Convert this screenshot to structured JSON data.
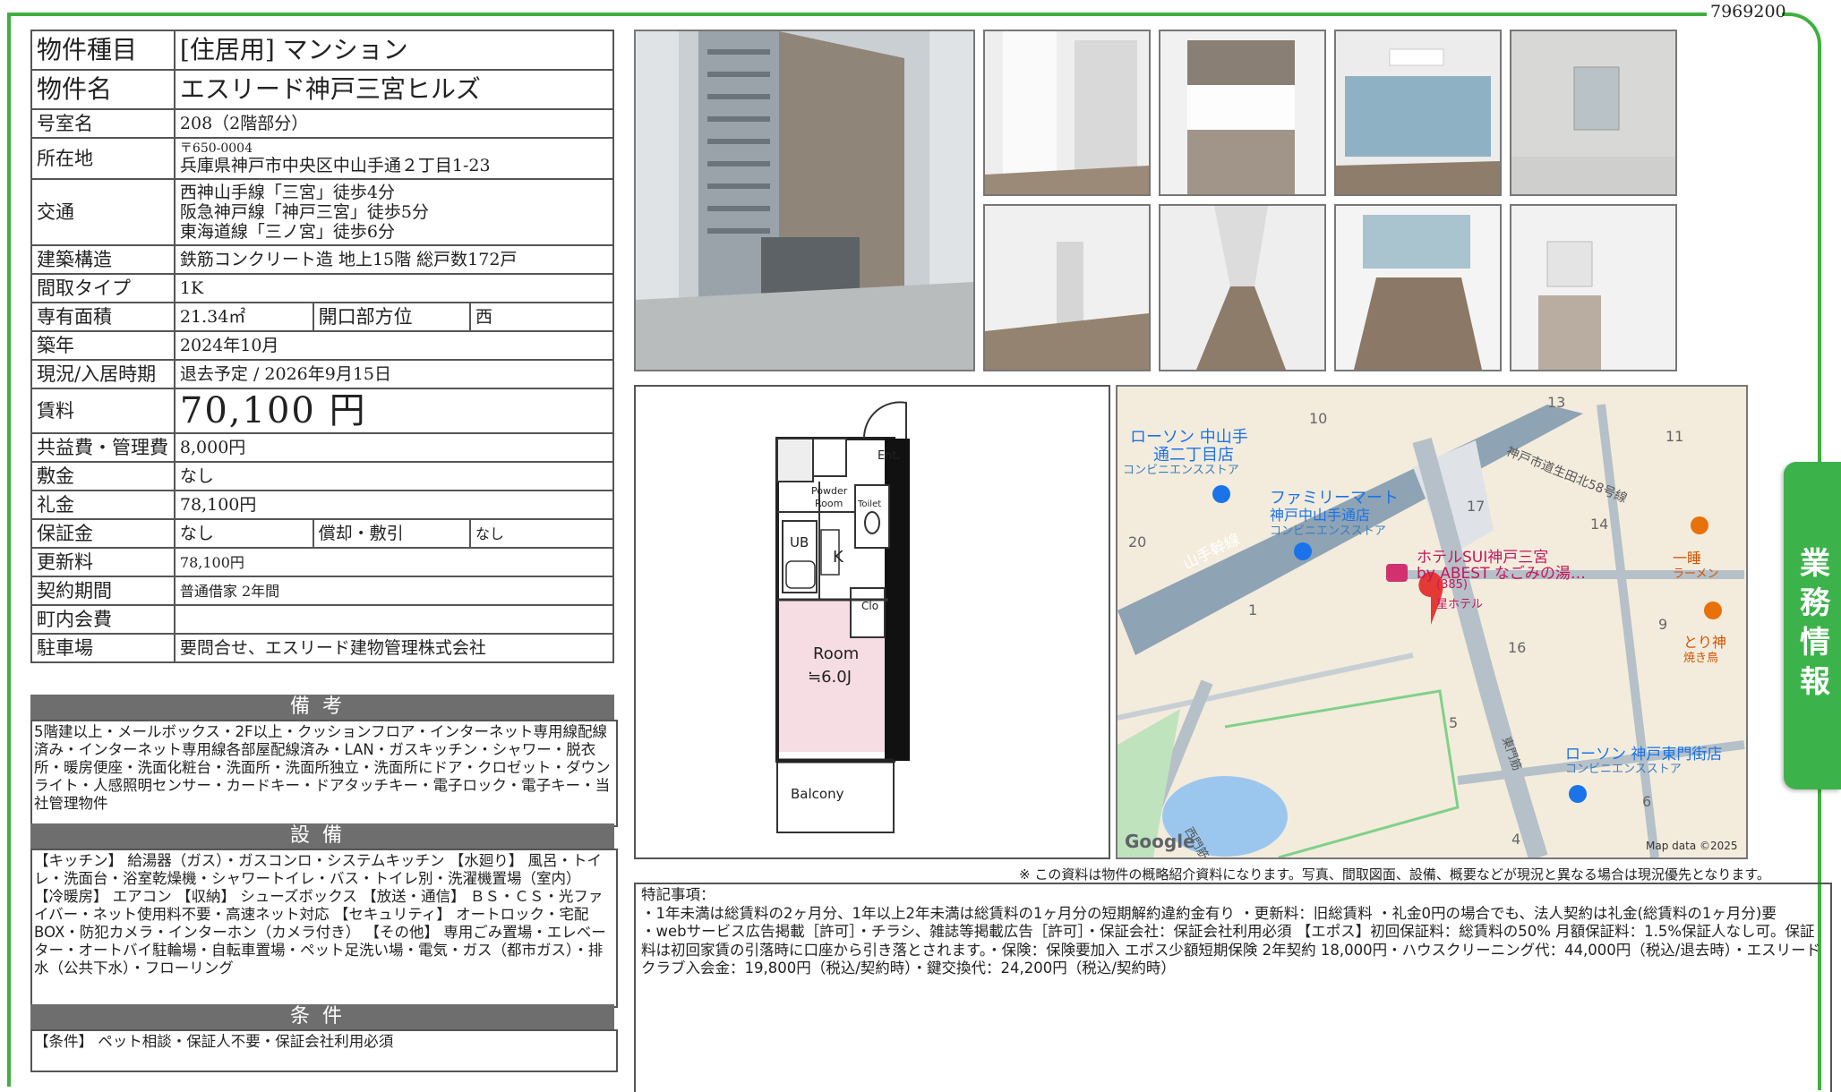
{
  "doc_id": "7969200",
  "side_tab": "業務情報",
  "spec": {
    "type_label": "物件種目",
    "type_value": "[住居用]  マンション",
    "name_label": "物件名",
    "name_value": "エスリード神戸三宮ヒルズ",
    "room_label": "号室名",
    "room_value": "208（2階部分）",
    "addr_label": "所在地",
    "addr_zip": "〒650-0004",
    "addr_value": "兵庫県神戸市中央区中山手通２丁目1-23",
    "access_label": "交通",
    "access_1": "西神山手線「三宮」徒歩4分",
    "access_2": "阪急神戸線「神戸三宮」徒歩5分",
    "access_3": "東海道線「三ノ宮」徒歩6分",
    "struct_label": "建築構造",
    "struct_value": "鉄筋コンクリート造  地上15階  総戸数172戸",
    "layout_label": "間取タイプ",
    "layout_value": "1K",
    "area_label": "専有面積",
    "area_value": "21.34㎡",
    "dir_label": "開口部方位",
    "dir_value": "西",
    "year_label": "築年",
    "year_value": "2024年10月",
    "status_label": "現況/入居時期",
    "status_value": "退去予定  /  2026年9月15日",
    "rent_label": "賃料",
    "rent_value": "70,100 円",
    "fee_label": "共益費・管理費",
    "fee_value": "8,000円",
    "deposit_label": "敷金",
    "deposit_value": "なし",
    "key_label": "礼金",
    "key_value": "78,100円",
    "guarantee_label": "保証金",
    "guarantee_value": "なし",
    "amort_label": "償却・敷引",
    "amort_value": "なし",
    "renew_label": "更新料",
    "renew_value": "78,100円",
    "contract_label": "契約期間",
    "contract_value": "普通借家  2年間",
    "town_label": "町内会費",
    "town_value": "",
    "parking_label": "駐車場",
    "parking_value": "要問合せ、エスリード建物管理株式会社"
  },
  "bikou": {
    "title": "備考",
    "text": "5階建以上・メールボックス・2F以上・クッションフロア・インターネット専用線配線済み・インターネット専用線各部屋配線済み・LAN・ガスキッチン・シャワー・脱衣所・暖房便座・洗面化粧台・洗面所・洗面所独立・洗面所にドア・クロゼット・ダウンライト・人感照明センサー・カードキー・ドアタッチキー・電子ロック・電子キー・当社管理物件"
  },
  "setsubi": {
    "title": "設備",
    "text": "【キッチン】 給湯器（ガス）・ガスコンロ・システムキッチン 【水廻り】 風呂・トイレ・洗面台・浴室乾燥機・シャワートイレ・バス・トイレ別・洗濯機置場（室内） 【冷暖房】 エアコン 【収納】 シューズボックス 【放送・通信】 ＢＳ・ＣＳ・光ファイバー・ネット使用料不要・高速ネット対応 【セキュリティ】 オートロック・宅配BOX・防犯カメラ・インターホン（カメラ付き） 【その他】 専用ごみ置場・エレベーター・オートバイ駐輪場・自転車置場・ペット足洗い場・電気・ガス（都市ガス）・排水（公共下水）・フローリング"
  },
  "jouken": {
    "title": "条件",
    "text": "【条件】 ペット相談・保証人不要・保証会社利用必須"
  },
  "floorplan": {
    "ent": "Ent.",
    "powder": "Powder",
    "room_word": "Room",
    "toilet": "Toilet",
    "ub": "UB",
    "k": "K",
    "clo": "Clo",
    "room_label": "Room",
    "room_size": "≒6.0J",
    "balcony": "Balcony"
  },
  "map": {
    "labels": [
      {
        "t": "ローソン 中山手",
        "c": "#1a73e8"
      },
      {
        "t": "通二丁目店",
        "c": "#1a73e8"
      },
      {
        "t": "コンビニエンスストア",
        "c": "#3c7dbb"
      },
      {
        "t": "ファミリーマート",
        "c": "#1a73e8"
      },
      {
        "t": "神戸中山手通店",
        "c": "#1a73e8"
      },
      {
        "t": "コンビニエンスストア",
        "c": "#3c7dbb"
      },
      {
        "t": "ホテルSUI神戸三宮",
        "c": "#c2185b"
      },
      {
        "t": "by ABEST なごみの湯…",
        "c": "#c2185b"
      },
      {
        "t": "(385)",
        "c": "#c2185b"
      },
      {
        "t": "星ホテル",
        "c": "#c2185b"
      },
      {
        "t": "一睡",
        "c": "#d35400"
      },
      {
        "t": "ラーメン",
        "c": "#d35400"
      },
      {
        "t": "とり神",
        "c": "#d35400"
      },
      {
        "t": "焼き鳥",
        "c": "#d35400"
      },
      {
        "t": "ローソン 神戸東門街店",
        "c": "#1a73e8"
      },
      {
        "t": "コンビニエンスストア",
        "c": "#3c7dbb"
      },
      {
        "t": "山手幹線",
        "c": "#fff"
      },
      {
        "t": "神戸市道生田北58号線",
        "c": "#555"
      },
      {
        "t": "東門筋",
        "c": "#555"
      },
      {
        "t": "西門筋",
        "c": "#555"
      }
    ],
    "numbers": [
      "10",
      "13",
      "11",
      "17",
      "14",
      "20",
      "1",
      "16",
      "9",
      "5",
      "6",
      "4"
    ],
    "google": "Google",
    "credit": "Map data ©2025"
  },
  "disclaimer": "※ この資料は物件の概略紹介資料になります。写真、間取図面、設備、概要などが現況と異なる場合は現況優先となります。",
  "remarks": {
    "title": "特記事項：",
    "line1": "・1年未満は総賃料の2ヶ月分、1年以上2年未満は総賃料の1ヶ月分の短期解約違約金有り  ・更新料：旧総賃料  ・礼金0円の場合でも、法人契約は礼金(総賃料の1ヶ月分)要",
    "line2": "・webサービス広告掲載［許可］・チラシ、雑誌等掲載広告［許可］・保証会社：保証会社利用必須 【エポス】初回保証料：総賃料の50% 月額保証料：1.5%保証人なし可。保証料は初回家賃の引落時に口座から引き落とされます。・保険：保険要加入 エポス少額短期保険 2年契約 18,000円・ハウスクリーニング代：44,000円（税込/退去時）・エスリードクラブ入会金：19,800円（税込/契約時）・鍵交換代：24,200円（税込/契約時）"
  },
  "photos": [
    "building-exterior",
    "closet",
    "kitchen",
    "room-window",
    "bathroom",
    "room-corner",
    "hallway",
    "room-balcony-view",
    "washroom"
  ]
}
